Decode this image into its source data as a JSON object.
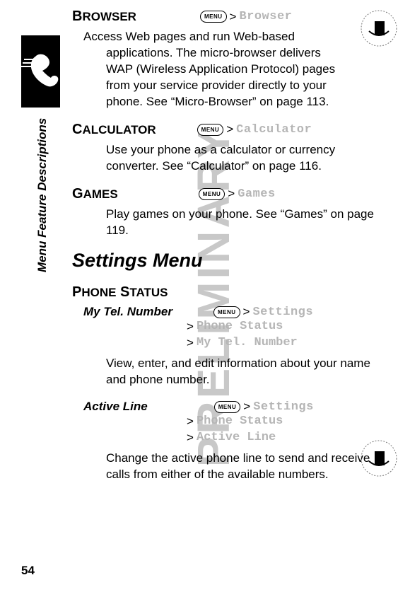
{
  "page_number": "54",
  "sidebar_label": "Menu Feature Descriptions",
  "watermark": "PRELIMINARY",
  "menu_button_label": "MENU",
  "sep": ">",
  "features": {
    "browser": {
      "name_first": "B",
      "name_rest": "ROWSER",
      "path_token": "Browser",
      "desc": "Access Web pages and run Web-based applications. The micro-browser delivers WAP (Wireless Application Protocol) pages from your service provider directly to your phone. See “Micro-Browser” on page 113."
    },
    "calculator": {
      "name_first": "C",
      "name_rest": "ALCULATOR",
      "path_token": "Calculator",
      "desc": "Use your phone as a calculator or currency converter. See “Calculator” on page 116."
    },
    "games": {
      "name_first": "G",
      "name_rest": "AMES",
      "path_token": "Games",
      "desc": "Play games on your phone. See “Games” on page 119."
    }
  },
  "section_title": "Settings Menu",
  "phone_status": {
    "heading_first": "P",
    "heading_mid": "HONE",
    "heading_sp": " S",
    "heading_end": "TATUS",
    "my_tel": {
      "name": "My Tel. Number",
      "p1": "Settings",
      "p2": "Phone Status",
      "p3": "My Tel. Number",
      "desc": "View, enter, and edit information about your name and phone number."
    },
    "active_line": {
      "name": "Active Line",
      "p1": "Settings",
      "p2": "Phone Status",
      "p3": "Active Line",
      "desc": "Change the active phone line to send and receive calls from either of the available numbers."
    }
  }
}
